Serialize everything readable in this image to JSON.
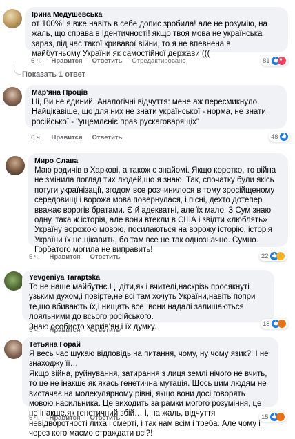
{
  "comments": [
    {
      "author": "Ірина Медушевська",
      "text": "от 100%! я вже навіть в себе допис зробила! але не розумію, на жаль, що справа в Ідентичності! якщо твоя мова не українська зараз, під час такої кривавої війни, то я не впевнена в майбутньому України як самостійної держави (((",
      "time": "6 ч.",
      "like": "Нравится",
      "reply": "Ответить",
      "edited": "Отредактировано",
      "reaction_count": "81"
    },
    {
      "author": "Мар'яна Проців",
      "text": "Ні, Ви не єдиний. Аналогічні відчуття: мене аж пересмикнуло. Найцікавіше, що для них не знати української - норма, не знати російської - \"ущемлєніє прав рускаговарящіх\"",
      "time": "6 ч.",
      "like": "Нравится",
      "reply": "Ответить",
      "edited": "",
      "reaction_count": "48"
    },
    {
      "author": "Миро Слава",
      "text": "Маю родичів в Харкові, а також є знайомі. Якщо коротко, то війна не змінила погляд тих людей,що я знаю. Так, спочатку були якісь потуги українізації, згодом все розчинилося в тому зросійщеному середовищі і ворожа мова повернулася, і пісні, дехто дотепер вважає ворогів братами. Є й адекватні, але їх мало. З Сум знаю одну, така ж історія, але вони втекли в США і звідти «люблять» Україну ворожою мовою, посилаються на ворожу історію, історія України їх не цікавить, бо там все не так однозначно. Сумно. Горбатого могила не виправить!",
      "time": "5 ч.",
      "like": "Нравится",
      "reply": "Ответить",
      "edited": "",
      "reaction_count": "22"
    },
    {
      "author": "Yevgeniya Taraptska",
      "text": "То не наше майбутнє.Ці діти,як і вчителі,наскрізь просякнуті узьким духом,і повірте,не всі там хочуть України,навіть попри те,що вбивають їх,і нищать все ,вони надалі залишаються лояльними до всього російського.\nЗнаю особисто харків'ян,і їх думку.",
      "time": "5 ч.",
      "like": "Нравится",
      "reply": "Ответить",
      "edited": "",
      "reaction_count": "18"
    },
    {
      "author": "Тетьяна Горай",
      "text": "Я весь час шукаю відповідь на питання, чому, ну чому язик?! І не знаходжу її…\nЯкщо війна, руйнування, затирання з лиця землі нічого не вчить, то це не інакше як якась генетична мутація. Щось цим людям не вистачає на молекулярному рівні, якщо вони досі говорять мовою насильника. Це виходить за рамки могого розуміння, це не інакше,як генетичний збій… І, на жаль, відчуття невідворотності лиха і смерті, і так нам всім і треба. Але чому і через кого маємо страждати всі?!",
      "time": "5 ч.",
      "like": "Нравится",
      "reply": "Ответить",
      "edited": "",
      "reaction_count": "15"
    }
  ],
  "show_reply": "Показать 1 ответ",
  "colors": {
    "bubble": "#f0f2f5",
    "secondary_text": "#65676b",
    "like_blue": "#1877f2"
  }
}
